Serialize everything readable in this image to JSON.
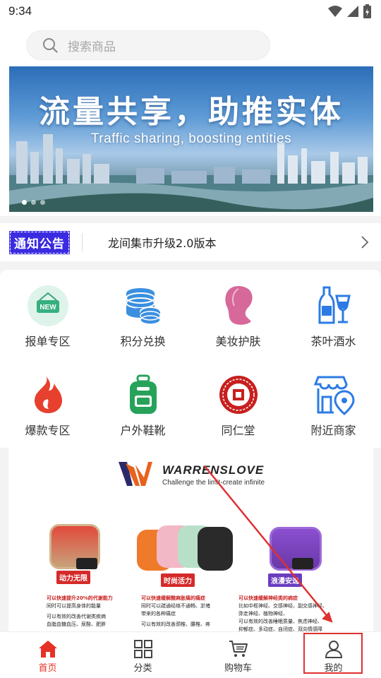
{
  "status_bar": {
    "time": "9:34"
  },
  "search": {
    "placeholder": "搜索商品"
  },
  "banner": {
    "title": "流量共享，助推实体",
    "subtitle": "Traffic sharing, boosting entities",
    "slide_count": 3,
    "active_slide": 1
  },
  "notice": {
    "badge": "通知公告",
    "text": "龙间集市升级2.0版本"
  },
  "categories": [
    {
      "label": "报单专区",
      "icon": "new-tag-icon"
    },
    {
      "label": "积分兑换",
      "icon": "coins-stack-icon"
    },
    {
      "label": "美妆护肤",
      "icon": "woman-face-icon"
    },
    {
      "label": "茶叶酒水",
      "icon": "wine-bottle-glass-icon"
    },
    {
      "label": "爆款专区",
      "icon": "fire-icon"
    },
    {
      "label": "户外鞋靴",
      "icon": "backpack-icon"
    },
    {
      "label": "同仁堂",
      "icon": "tongrentang-seal-icon"
    },
    {
      "label": "附近商家",
      "icon": "store-location-icon"
    }
  ],
  "product": {
    "brand": "WARRENSLOVE",
    "tagline": "Challenge the limit-create infinite",
    "bands": [
      {
        "label": "动力无限",
        "text_hl": "可以快速提升20%的代谢能力",
        "text": [
          "同时可以提高身体的能量",
          "可以有效的改善代谢类疾病",
          "血脂血糖血压、尿酸、肥胖"
        ]
      },
      {
        "label": "时尚活力",
        "text_hl": "可以快速缓解酸麻胀痛的痛症",
        "text": [
          "同时可以疏通经络不通畅、淤堵",
          "带来的各种痛症",
          "可以有效的改善颈椎、腰椎、疼"
        ]
      },
      {
        "label": "浪漫安逸",
        "text_hl": "可以快速缓解神经类的病症",
        "text": [
          "比如中枢神经、交感神经、副交感神经、",
          "弥走神经、植物神经、",
          "可以有效的改善睡眠质量、焦虑神经、",
          "抑郁症、多动症、自闭症、双向情感障"
        ]
      }
    ]
  },
  "bottom_nav": [
    {
      "label": "首页",
      "icon": "home-icon",
      "active": true
    },
    {
      "label": "分类",
      "icon": "grid-icon",
      "active": false
    },
    {
      "label": "购物车",
      "icon": "cart-icon",
      "active": false
    },
    {
      "label": "我的",
      "icon": "user-icon",
      "active": false
    }
  ],
  "colors": {
    "accent": "#e53224",
    "notice_badge": "#3b2be0",
    "annotation": "#e03030"
  }
}
